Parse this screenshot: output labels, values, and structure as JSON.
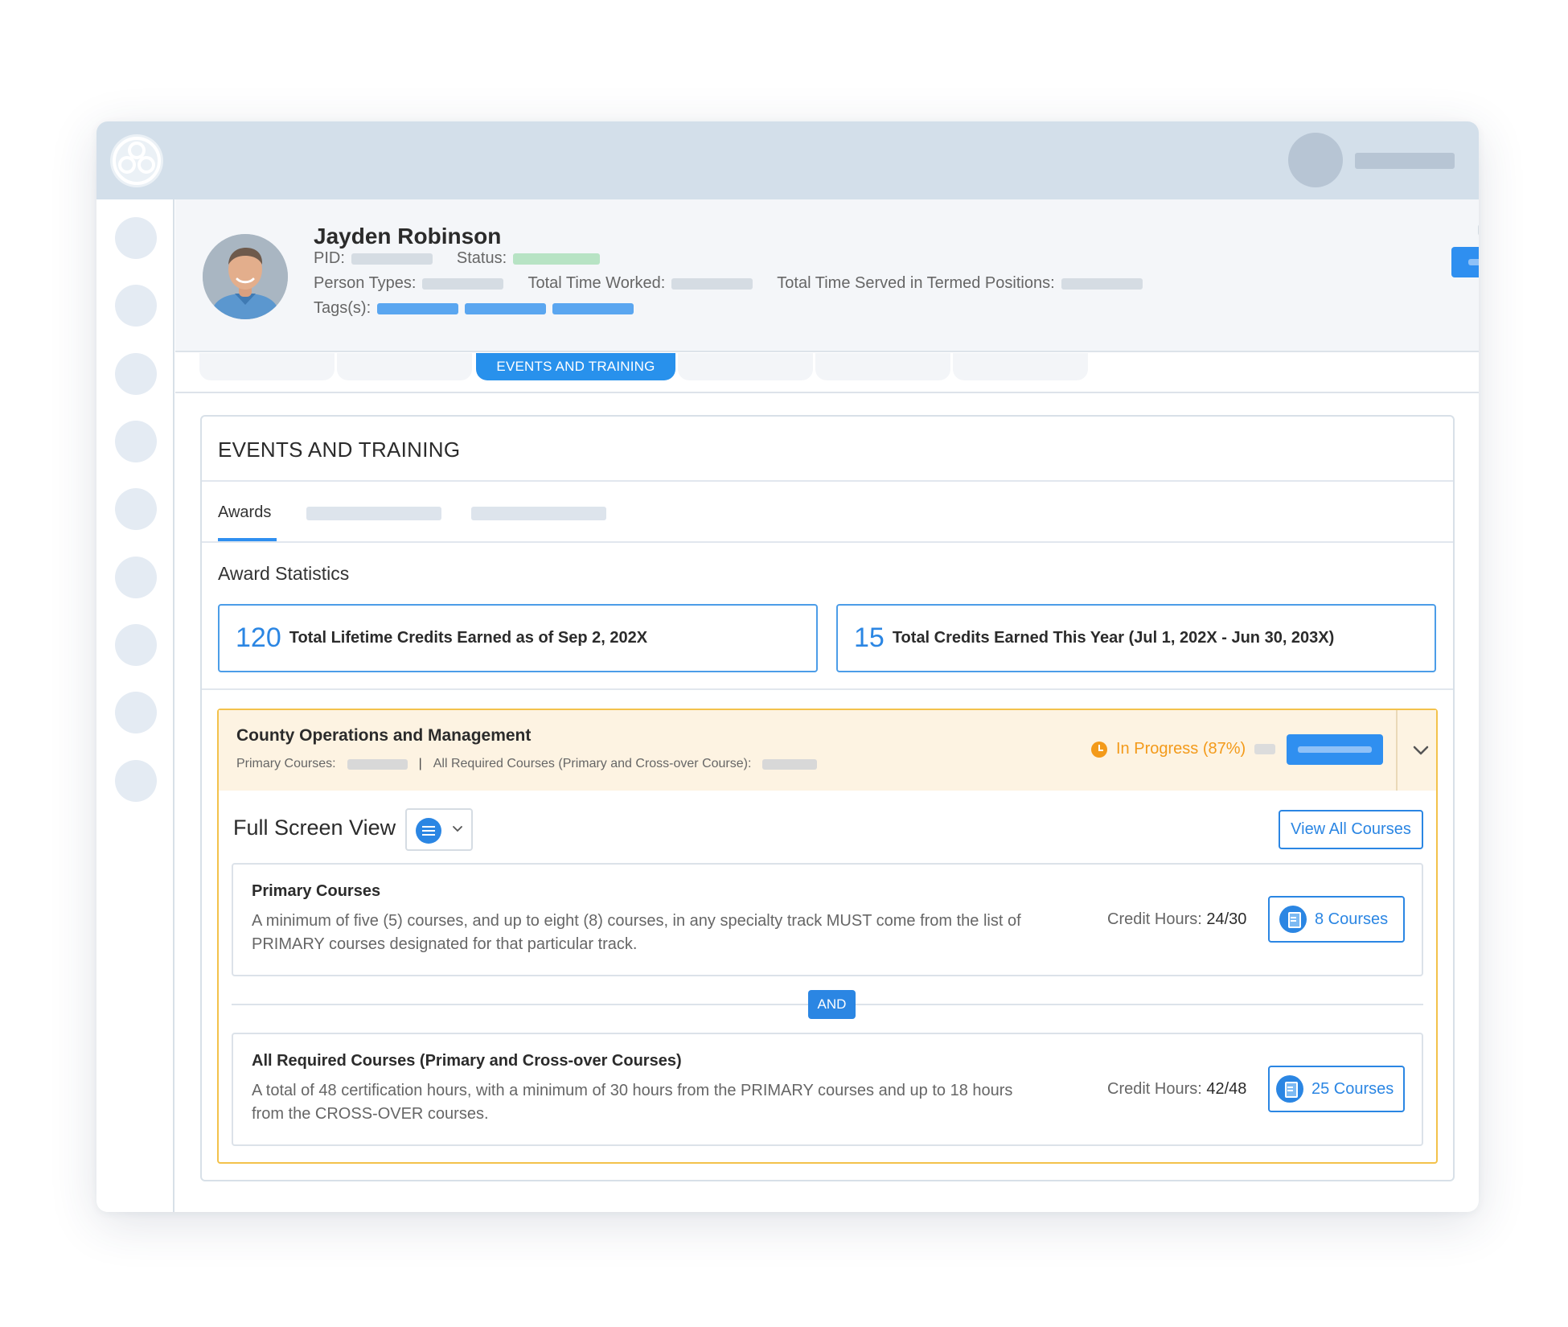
{
  "profile": {
    "name": "Jayden Robinson",
    "pid_label": "PID:",
    "status_label": "Status:",
    "person_types_label": "Person Types:",
    "time_worked_label": "Total Time Worked:",
    "time_served_label": "Total Time Served in Termed Positions:",
    "tags_label": "Tags(s):"
  },
  "main_tabs": {
    "active_label": "EVENTS AND TRAINING"
  },
  "section": {
    "title": "EVENTS AND TRAINING",
    "subtab_active": "Awards",
    "stats_title": "Award Statistics"
  },
  "stats": [
    {
      "value": "120",
      "label": "Total Lifetime Credits Earned as of Sep 2, 202X"
    },
    {
      "value": "15",
      "label": "Total Credits Earned This Year (Jul 1, 202X - Jun 30, 203X)"
    }
  ],
  "award": {
    "title": "County Operations and Management",
    "primary_label": "Primary Courses:",
    "divider": "|",
    "required_label": "All Required Courses (Primary and Cross-over Course):",
    "status": "In Progress (87%)",
    "progress_percent": 87,
    "status_color": "#f39a1a"
  },
  "view": {
    "label": "Full Screen View",
    "view_all": "View All Courses"
  },
  "requirements": [
    {
      "title": "Primary Courses",
      "description": "A minimum of five (5) courses, and up to eight (8) courses, in any specialty track MUST come from the list of PRIMARY courses designated for that particular track.",
      "credit_label": "Credit Hours:",
      "credit_value": "24/30",
      "courses": "8 Courses"
    },
    {
      "title": "All Required Courses (Primary and Cross-over Courses)",
      "description": "A total of 48 certification hours, with a minimum of 30 hours from the PRIMARY courses and up to 18 hours from the CROSS-OVER courses.",
      "credit_label": "Credit Hours:",
      "credit_value": "42/48",
      "courses": "25 Courses"
    }
  ],
  "connector": "AND",
  "colors": {
    "accent": "#2b86e3",
    "header_bg": "#d3dfea",
    "award_border": "#f3c24b",
    "award_head_bg": "#fdf3e2"
  }
}
